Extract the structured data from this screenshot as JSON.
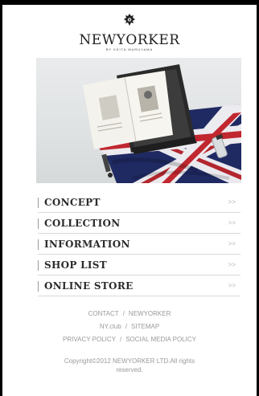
{
  "logo": {
    "name": "NEWYORKER",
    "subtitle": "BY KEITA MARUYAMA",
    "emblem_icon": "crest-icon"
  },
  "hero": {
    "icon": "magazine-flag-photo"
  },
  "menu": {
    "items": [
      {
        "label": "CONCEPT",
        "arrow": ">>"
      },
      {
        "label": "COLLECTION",
        "arrow": ">>"
      },
      {
        "label": "INFORMATION",
        "arrow": ">>"
      },
      {
        "label": "SHOP LIST",
        "arrow": ">>"
      },
      {
        "label": "ONLINE STORE",
        "arrow": ">>"
      }
    ]
  },
  "footer": {
    "row1": {
      "left": "CONTACT",
      "sep": "/",
      "right": "NEWYORKER"
    },
    "row2": {
      "left": "NY.club",
      "sep": "/",
      "right": "SITEMAP"
    },
    "row3": {
      "left": "PRIVACY POLICY",
      "sep": "/",
      "right": "SOCIAL MEDIA POLICY"
    },
    "copyright_line1": "Copyright©2012 NEWYORKER LTD.All rights",
    "copyright_line2": "reserved."
  },
  "colors": {
    "frame": "#000000",
    "text": "#2b2b2b",
    "muted": "#9a9a9a",
    "divider": "#d9d9d9"
  }
}
